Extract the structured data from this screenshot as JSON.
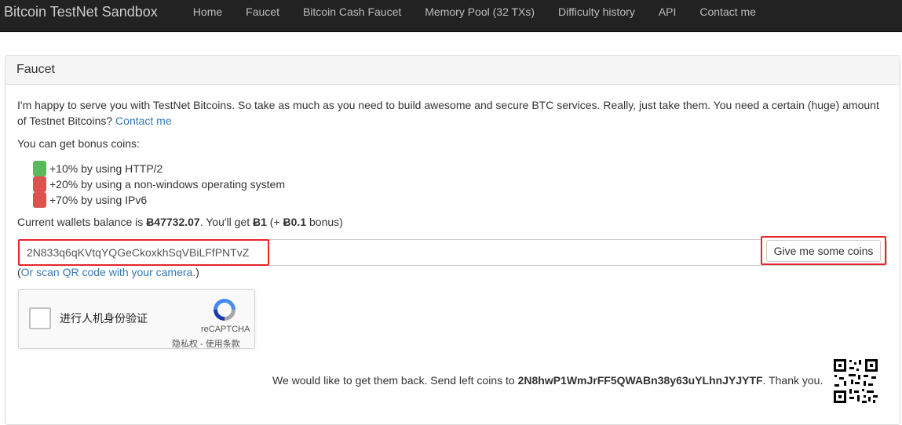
{
  "navbar": {
    "brand": "Bitcoin TestNet Sandbox",
    "links": [
      "Home",
      "Faucet",
      "Bitcoin Cash Faucet",
      "Memory Pool (32 TXs)",
      "Difficulty history",
      "API",
      "Contact me"
    ]
  },
  "panel": {
    "title": "Faucet",
    "intro": "I'm happy to serve you with TestNet Bitcoins. So take as much as you need to build awesome and secure BTC services. Really, just take them. You need a certain (huge) amount of Testnet Bitcoins?",
    "contact_link": "Contact me",
    "bonus_heading": "You can get bonus coins:",
    "bonuses": [
      {
        "text": "+10% by using HTTP/2",
        "color": "#5cb85c"
      },
      {
        "text": "+20% by using a non-windows operating system",
        "color": "#d9534f"
      },
      {
        "text": "+70% by using IPv6",
        "color": "#d9534f"
      }
    ],
    "balance": {
      "prefix": "Current wallets balance is ",
      "amount": "Ƀ47732.07",
      "middle": ". You'll get ",
      "get": "Ƀ1",
      "bonus_prefix": " (+ ",
      "bonus": "Ƀ0.1",
      "suffix": " bonus)"
    },
    "address_value": "2N833q6qKVtqYQGeCkoxkhSqVBiLFfPNTvZ",
    "button_label": "Give me some coins",
    "qr_hint": {
      "open": "(",
      "link": "Or scan QR code with your camera.",
      "close": ")"
    },
    "captcha": {
      "label": "进行人机身份验证",
      "brand": "reCAPTCHA",
      "terms": "隐私权 - 使用条款"
    },
    "footer": {
      "prefix": "We would like to get them back. Send left coins to ",
      "address": "2N8hwP1WmJrFF5QWABn38y63uYLhnJYJYTF",
      "suffix": ". Thank you."
    }
  },
  "colors": {
    "navbar": "#222222",
    "link": "#337ab7",
    "highlight": "#e5252a"
  },
  "icons": [
    "recaptcha-logo-icon",
    "qr-code-icon"
  ]
}
